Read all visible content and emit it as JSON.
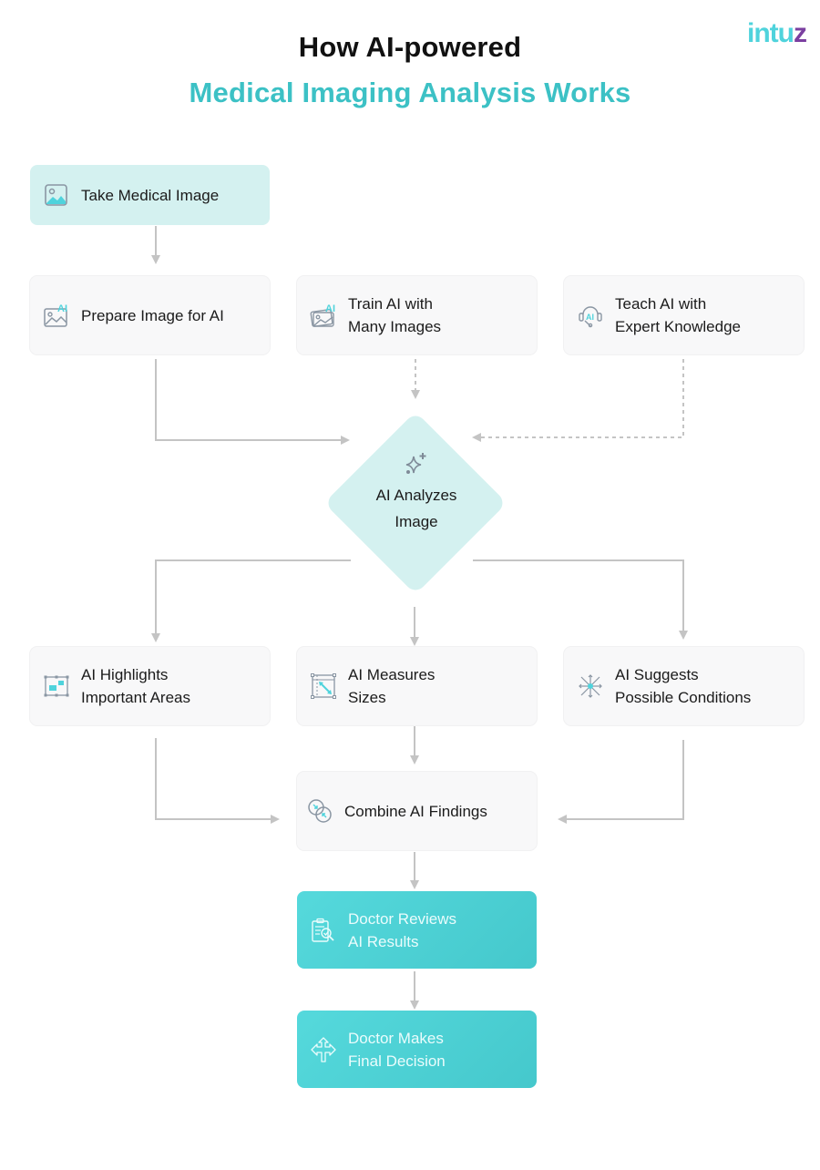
{
  "header": {
    "title_line1": "How AI-powered",
    "title_line2": "Medical Imaging Analysis Works",
    "logo_text": "intu",
    "logo_accent": "z"
  },
  "colors": {
    "accent": "#3cc1c5",
    "node_light": "#d4f1f0",
    "node_teal": "#4fd1d5",
    "node_neutral": "#f8f8f9",
    "connector": "#c4c4c4"
  },
  "nodes": {
    "take_image": {
      "label": "Take Medical Image",
      "icon": "image-icon"
    },
    "prepare_image": {
      "label": "Prepare Image for AI",
      "icon": "ai-image-icon"
    },
    "train_ai": {
      "label_line1": "Train AI with",
      "label_line2": "Many Images",
      "icon": "ai-images-stack-icon"
    },
    "teach_ai": {
      "label_line1": "Teach AI with",
      "label_line2": "Expert Knowledge",
      "icon": "ai-headset-icon"
    },
    "analyze": {
      "label_line1": "AI Analyzes",
      "label_line2": "Image",
      "icon": "sparkles-icon"
    },
    "highlights": {
      "label_line1": "AI Highlights",
      "label_line2": "Important Areas",
      "icon": "highlight-areas-icon"
    },
    "measures": {
      "label_line1": "AI Measures",
      "label_line2": "Sizes",
      "icon": "measure-icon"
    },
    "suggests": {
      "label_line1": "AI Suggests",
      "label_line2": "Possible Conditions",
      "icon": "expand-arrows-icon"
    },
    "combine": {
      "label": "Combine AI Findings",
      "icon": "merge-circles-icon"
    },
    "doctor_reviews": {
      "label_line1": "Doctor Reviews",
      "label_line2": "AI Results",
      "icon": "clipboard-search-icon"
    },
    "doctor_decides": {
      "label_line1": "Doctor Makes",
      "label_line2": "Final Decision",
      "icon": "split-arrows-icon"
    }
  },
  "edges": [
    {
      "from": "Take Medical Image",
      "to": "Prepare Image for AI",
      "style": "solid"
    },
    {
      "from": "Prepare Image for AI",
      "to": "AI Analyzes Image",
      "style": "solid"
    },
    {
      "from": "Train AI with Many Images",
      "to": "AI Analyzes Image",
      "style": "dashed"
    },
    {
      "from": "Teach AI with Expert Knowledge",
      "to": "AI Analyzes Image",
      "style": "dashed"
    },
    {
      "from": "AI Analyzes Image",
      "to": "AI Highlights Important Areas",
      "style": "solid"
    },
    {
      "from": "AI Analyzes Image",
      "to": "AI Measures Sizes",
      "style": "solid"
    },
    {
      "from": "AI Analyzes Image",
      "to": "AI Suggests Possible Conditions",
      "style": "solid"
    },
    {
      "from": "AI Highlights Important Areas",
      "to": "Combine AI Findings",
      "style": "solid"
    },
    {
      "from": "AI Measures Sizes",
      "to": "Combine AI Findings",
      "style": "solid"
    },
    {
      "from": "AI Suggests Possible Conditions",
      "to": "Combine AI Findings",
      "style": "solid"
    },
    {
      "from": "Combine AI Findings",
      "to": "Doctor Reviews AI Results",
      "style": "solid"
    },
    {
      "from": "Doctor Reviews AI Results",
      "to": "Doctor Makes Final Decision",
      "style": "solid"
    }
  ]
}
